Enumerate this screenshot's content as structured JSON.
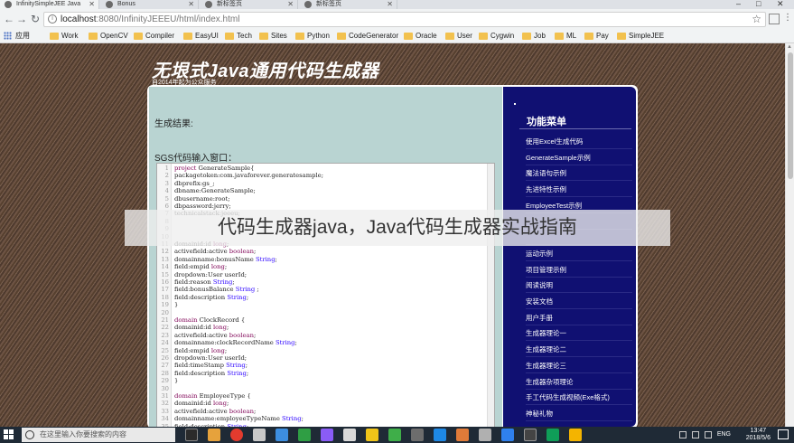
{
  "tabs": [
    {
      "title": "InfinitySimpleJEE Java",
      "active": true
    },
    {
      "title": "Bonus",
      "active": false
    },
    {
      "title": "新标签页",
      "active": false
    },
    {
      "title": "新标签页",
      "active": false
    }
  ],
  "window_controls": {
    "minimize": "–",
    "maximize": "□",
    "close": "✕"
  },
  "toolbar": {
    "back": "←",
    "forward": "→",
    "reload": "↻",
    "url_host": "localhost",
    "url_rest": ":8080/InfinityJEEEU/html/index.html",
    "star": "☆"
  },
  "bookmarks": [
    "应用",
    "Work",
    "OpenCV",
    "Compiler",
    "EasyUI",
    "Tech",
    "Sites",
    "Python",
    "CodeGenerator",
    "Oracle",
    "User",
    "Cygwin",
    "Job",
    "ML",
    "Pay",
    "SimpleJEE"
  ],
  "page": {
    "title": "无垠式Java通用代码生成器",
    "subtitle": "自2014年起为公众服务",
    "result_label": "生成结果:",
    "sgs_label": "SGS代码输入窗口：",
    "menu_title": "功能菜单",
    "menu_items": [
      "使用Excel生成代码",
      "GenerateSample示例",
      "魔法语句示例",
      "先进特性示例",
      "EmployeeTest示例",
      "",
      "",
      "运动示例",
      "项目管理示例",
      "阅读说明",
      "安装文档",
      "用户手册",
      "生成器理论一",
      "生成器理论二",
      "生成器理论三",
      "生成器杂项理论",
      "手工代码生成视频(Exe格式)",
      "神秘礼物"
    ],
    "banner": "代码生成器java，Java代码生成器实战指南"
  },
  "code_lines": [
    {
      "n": "1",
      "parts": [
        [
          "kw",
          "project "
        ],
        [
          "tx",
          "GenerateSample{"
        ]
      ]
    },
    {
      "n": "2",
      "parts": [
        [
          "tx",
          "packagetoken:com.javaforever.generatesample;"
        ]
      ]
    },
    {
      "n": "3",
      "parts": [
        [
          "tx",
          "dbprefix:gs_;"
        ]
      ]
    },
    {
      "n": "4",
      "parts": [
        [
          "tx",
          "dbname:GenerateSample;"
        ]
      ]
    },
    {
      "n": "5",
      "parts": [
        [
          "tx",
          "dbusername:root;"
        ]
      ]
    },
    {
      "n": "6",
      "parts": [
        [
          "tx",
          "dbpassword:jerry;"
        ]
      ]
    },
    {
      "n": "7",
      "parts": [
        [
          "tx",
          "technicalstack:jeeeu;"
        ]
      ]
    },
    {
      "n": "8",
      "parts": [
        [
          "tx",
          ""
        ]
      ]
    },
    {
      "n": "9",
      "parts": [
        [
          "tx",
          ""
        ]
      ]
    },
    {
      "n": "10",
      "parts": [
        [
          "tx",
          ""
        ]
      ]
    },
    {
      "n": "11",
      "parts": [
        [
          "tx",
          "domainid:id "
        ],
        [
          "kw",
          "long"
        ],
        [
          "tx",
          ";"
        ]
      ]
    },
    {
      "n": "12",
      "parts": [
        [
          "tx",
          "activefield:active "
        ],
        [
          "kw",
          "boolean"
        ],
        [
          "tx",
          ";"
        ]
      ]
    },
    {
      "n": "13",
      "parts": [
        [
          "tx",
          "domainname:bonusName "
        ],
        [
          "ty",
          "String"
        ],
        [
          "tx",
          ";"
        ]
      ]
    },
    {
      "n": "14",
      "parts": [
        [
          "tx",
          "field:empid "
        ],
        [
          "kw",
          "long"
        ],
        [
          "tx",
          ";"
        ]
      ]
    },
    {
      "n": "15",
      "parts": [
        [
          "tx",
          "dropdown:User userId;"
        ]
      ]
    },
    {
      "n": "16",
      "parts": [
        [
          "tx",
          "field:reason "
        ],
        [
          "ty",
          "String"
        ],
        [
          "tx",
          ";"
        ]
      ]
    },
    {
      "n": "17",
      "parts": [
        [
          "tx",
          "field:bonusBalance "
        ],
        [
          "ty",
          "String"
        ],
        [
          "tx",
          " ;"
        ]
      ]
    },
    {
      "n": "18",
      "parts": [
        [
          "tx",
          "field:description "
        ],
        [
          "ty",
          "String"
        ],
        [
          "tx",
          ";"
        ]
      ]
    },
    {
      "n": "19",
      "parts": [
        [
          "tx",
          "}"
        ]
      ]
    },
    {
      "n": "20",
      "parts": [
        [
          "tx",
          ""
        ]
      ]
    },
    {
      "n": "21",
      "parts": [
        [
          "kw",
          "domain "
        ],
        [
          "tx",
          "ClockRecord {"
        ]
      ]
    },
    {
      "n": "22",
      "parts": [
        [
          "tx",
          "domainid:id "
        ],
        [
          "kw",
          "long"
        ],
        [
          "tx",
          ";"
        ]
      ]
    },
    {
      "n": "23",
      "parts": [
        [
          "tx",
          "activefield:active "
        ],
        [
          "kw",
          "boolean"
        ],
        [
          "tx",
          ";"
        ]
      ]
    },
    {
      "n": "24",
      "parts": [
        [
          "tx",
          "domainname:clockRecordName "
        ],
        [
          "ty",
          "String"
        ],
        [
          "tx",
          ";"
        ]
      ]
    },
    {
      "n": "25",
      "parts": [
        [
          "tx",
          "field:empid "
        ],
        [
          "kw",
          "long"
        ],
        [
          "tx",
          ";"
        ]
      ]
    },
    {
      "n": "26",
      "parts": [
        [
          "tx",
          "dropdown:User userId;"
        ]
      ]
    },
    {
      "n": "27",
      "parts": [
        [
          "tx",
          "field:timeStamp "
        ],
        [
          "ty",
          "String"
        ],
        [
          "tx",
          ";"
        ]
      ]
    },
    {
      "n": "28",
      "parts": [
        [
          "tx",
          "field:description "
        ],
        [
          "ty",
          "String"
        ],
        [
          "tx",
          ";"
        ]
      ]
    },
    {
      "n": "29",
      "parts": [
        [
          "tx",
          "}"
        ]
      ]
    },
    {
      "n": "30",
      "parts": [
        [
          "tx",
          ""
        ]
      ]
    },
    {
      "n": "31",
      "parts": [
        [
          "kw",
          "domain "
        ],
        [
          "tx",
          "EmployeeType {"
        ]
      ]
    },
    {
      "n": "32",
      "parts": [
        [
          "tx",
          "domainid:id "
        ],
        [
          "kw",
          "long"
        ],
        [
          "tx",
          ";"
        ]
      ]
    },
    {
      "n": "33",
      "parts": [
        [
          "tx",
          "activefield:active "
        ],
        [
          "kw",
          "boolean"
        ],
        [
          "tx",
          ";"
        ]
      ]
    },
    {
      "n": "34",
      "parts": [
        [
          "tx",
          "domainname:employeeTypeName "
        ],
        [
          "ty",
          "String"
        ],
        [
          "tx",
          ";"
        ]
      ]
    },
    {
      "n": "35",
      "parts": [
        [
          "tx",
          "field:description "
        ],
        [
          "ty",
          "String"
        ],
        [
          "tx",
          ";"
        ]
      ]
    }
  ],
  "taskbar": {
    "search_placeholder": "在这里输入你要搜索的内容",
    "lang": "ENG",
    "time": "13:47",
    "date": "2018/5/6"
  },
  "colors": {
    "side_menu_bg": "#101072",
    "main_pane_bg": "#b9d4d2",
    "keyword": "#7f0055",
    "type": "#2a00ff"
  }
}
